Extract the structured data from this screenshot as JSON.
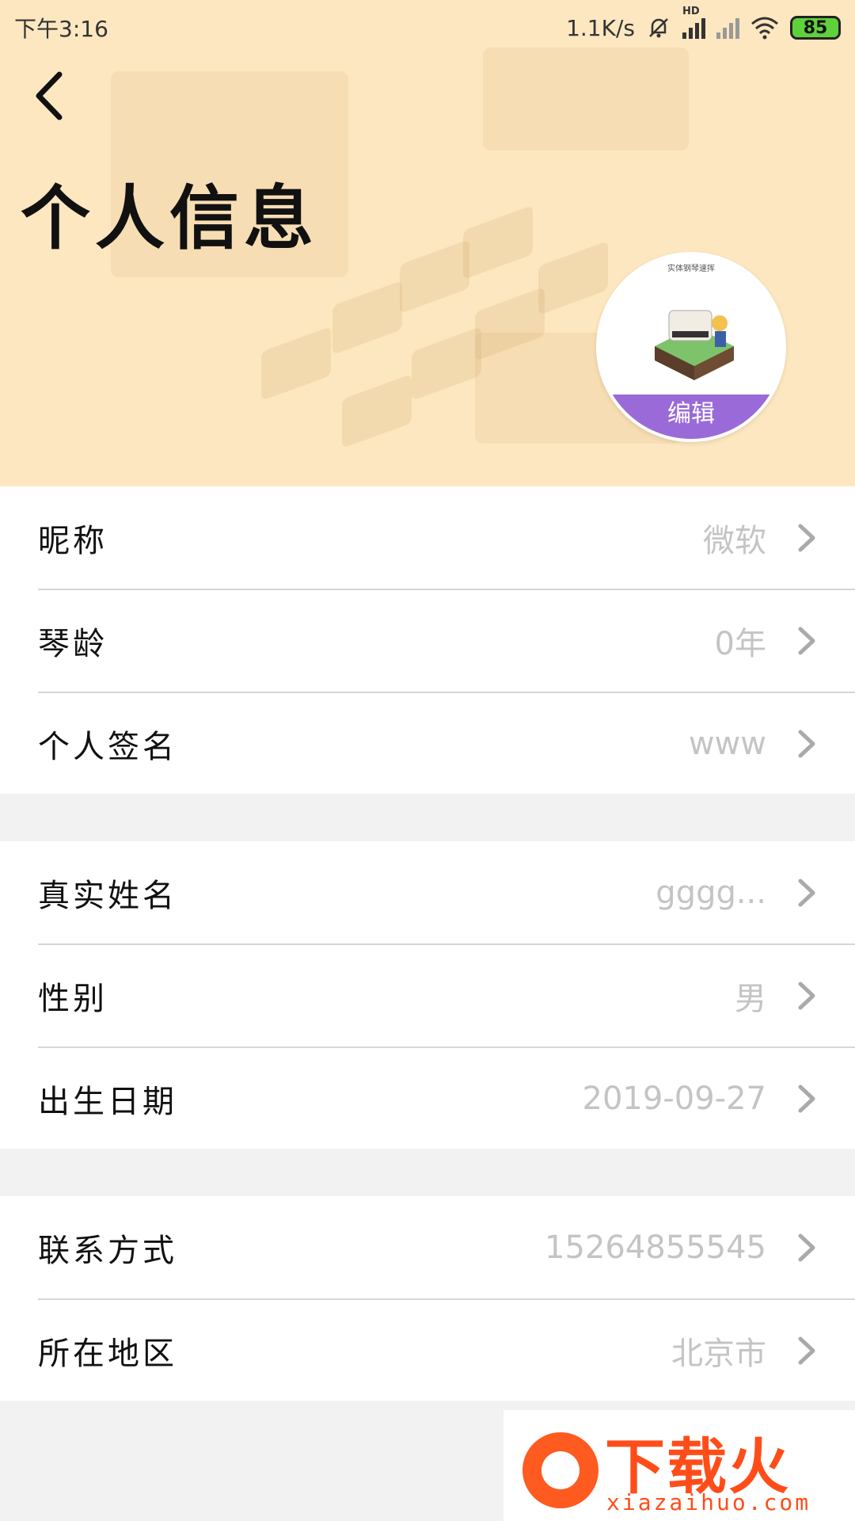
{
  "status_bar": {
    "time": "下午3:16",
    "network_speed": "1.1K/s",
    "hd_label": "HD",
    "battery": "85"
  },
  "header": {
    "title": "个人信息",
    "avatar": {
      "mini_title": "实体钢琴速挥",
      "edit_label": "编辑"
    }
  },
  "sections": [
    {
      "rows": [
        {
          "label": "昵称",
          "value": "微软"
        },
        {
          "label": "琴龄",
          "value": "0年"
        },
        {
          "label": "个人签名",
          "value": "www"
        }
      ]
    },
    {
      "rows": [
        {
          "label": "真实姓名",
          "value": "gggg..."
        },
        {
          "label": "性别",
          "value": "男"
        },
        {
          "label": "出生日期",
          "value": "2019-09-27"
        }
      ]
    },
    {
      "rows": [
        {
          "label": "联系方式",
          "value": "15264855545"
        },
        {
          "label": "所在地区",
          "value": "北京市"
        }
      ]
    }
  ],
  "watermark": {
    "brand": "下载火",
    "url": "xiazaihuo.com"
  },
  "colors": {
    "header_bg": "#fde7c0",
    "edit_badge": "#9b6ad9",
    "value_text": "#c4c4c4",
    "battery": "#5fd13a"
  }
}
